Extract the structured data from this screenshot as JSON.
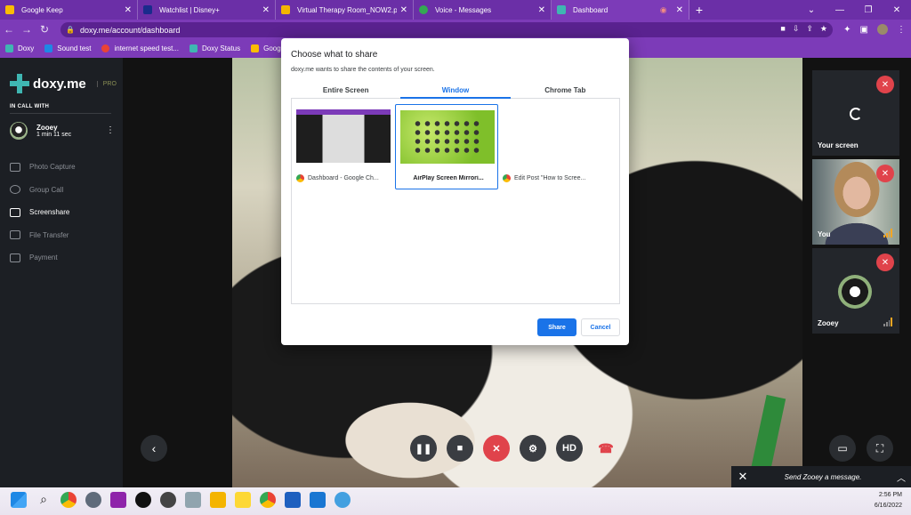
{
  "browser": {
    "tabs": [
      {
        "title": "Google Keep",
        "color": "#fbbc04"
      },
      {
        "title": "Watchlist | Disney+",
        "color": "#1a2b8c"
      },
      {
        "title": "Virtual Therapy Room_NOW2.pp",
        "color": "#f4b400"
      },
      {
        "title": "Voice - Messages",
        "color": "#34a853"
      },
      {
        "title": "Dashboard",
        "color": "#3fb6b2"
      }
    ],
    "url": "doxy.me/account/dashboard",
    "bookmarks": [
      {
        "label": "Doxy",
        "color": "#3fb6b2"
      },
      {
        "label": "Sound test",
        "color": "#1e88e5"
      },
      {
        "label": "internet speed test...",
        "color": "#ea4335"
      },
      {
        "label": "Doxy Status",
        "color": "#3fb6b2"
      },
      {
        "label": "Google",
        "color": "#fbbc04"
      }
    ]
  },
  "sidebar": {
    "brand": "doxy.me",
    "plan": "PRO",
    "in_call_with": "IN CALL WITH",
    "callee_name": "Zooey",
    "callee_duration": "1 min 11 sec",
    "menu": [
      {
        "label": "Photo Capture",
        "icon": "camera-icon"
      },
      {
        "label": "Group Call",
        "icon": "group-icon"
      },
      {
        "label": "Screenshare",
        "icon": "monitor-icon"
      },
      {
        "label": "File Transfer",
        "icon": "upload-icon"
      },
      {
        "label": "Payment",
        "icon": "card-icon"
      }
    ]
  },
  "dialog": {
    "title": "Choose what to share",
    "subtitle": "doxy.me wants to share the contents of your screen.",
    "tabs": [
      "Entire Screen",
      "Window",
      "Chrome Tab"
    ],
    "sources": [
      {
        "caption": "Dashboard - Google Ch..."
      },
      {
        "caption": "AirPlay Screen Mirrori..."
      },
      {
        "caption": "Edit Post \"How to Scree..."
      }
    ],
    "share_label": "Share",
    "cancel_label": "Cancel"
  },
  "tiles": {
    "screen_label": "Your screen",
    "you_label": "You",
    "zooey_label": "Zooey"
  },
  "controls": {
    "hd_label": "HD",
    "message_placeholder": "Send Zooey a message."
  },
  "taskbar": {
    "time": "2:56 PM",
    "date": "6/16/2022"
  }
}
